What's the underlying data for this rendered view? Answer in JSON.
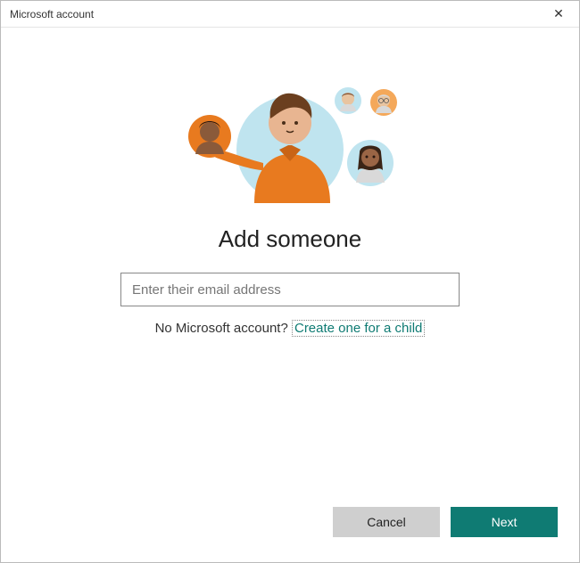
{
  "window": {
    "title": "Microsoft account",
    "close_icon": "✕"
  },
  "main": {
    "heading": "Add someone",
    "email_placeholder": "Enter their email address",
    "no_account_text": "No Microsoft account? ",
    "create_link": "Create one for a child"
  },
  "footer": {
    "cancel_label": "Cancel",
    "next_label": "Next"
  },
  "colors": {
    "accent": "#0f7b73",
    "orange": "#e87a1f",
    "light_blue": "#bfe4ef"
  }
}
